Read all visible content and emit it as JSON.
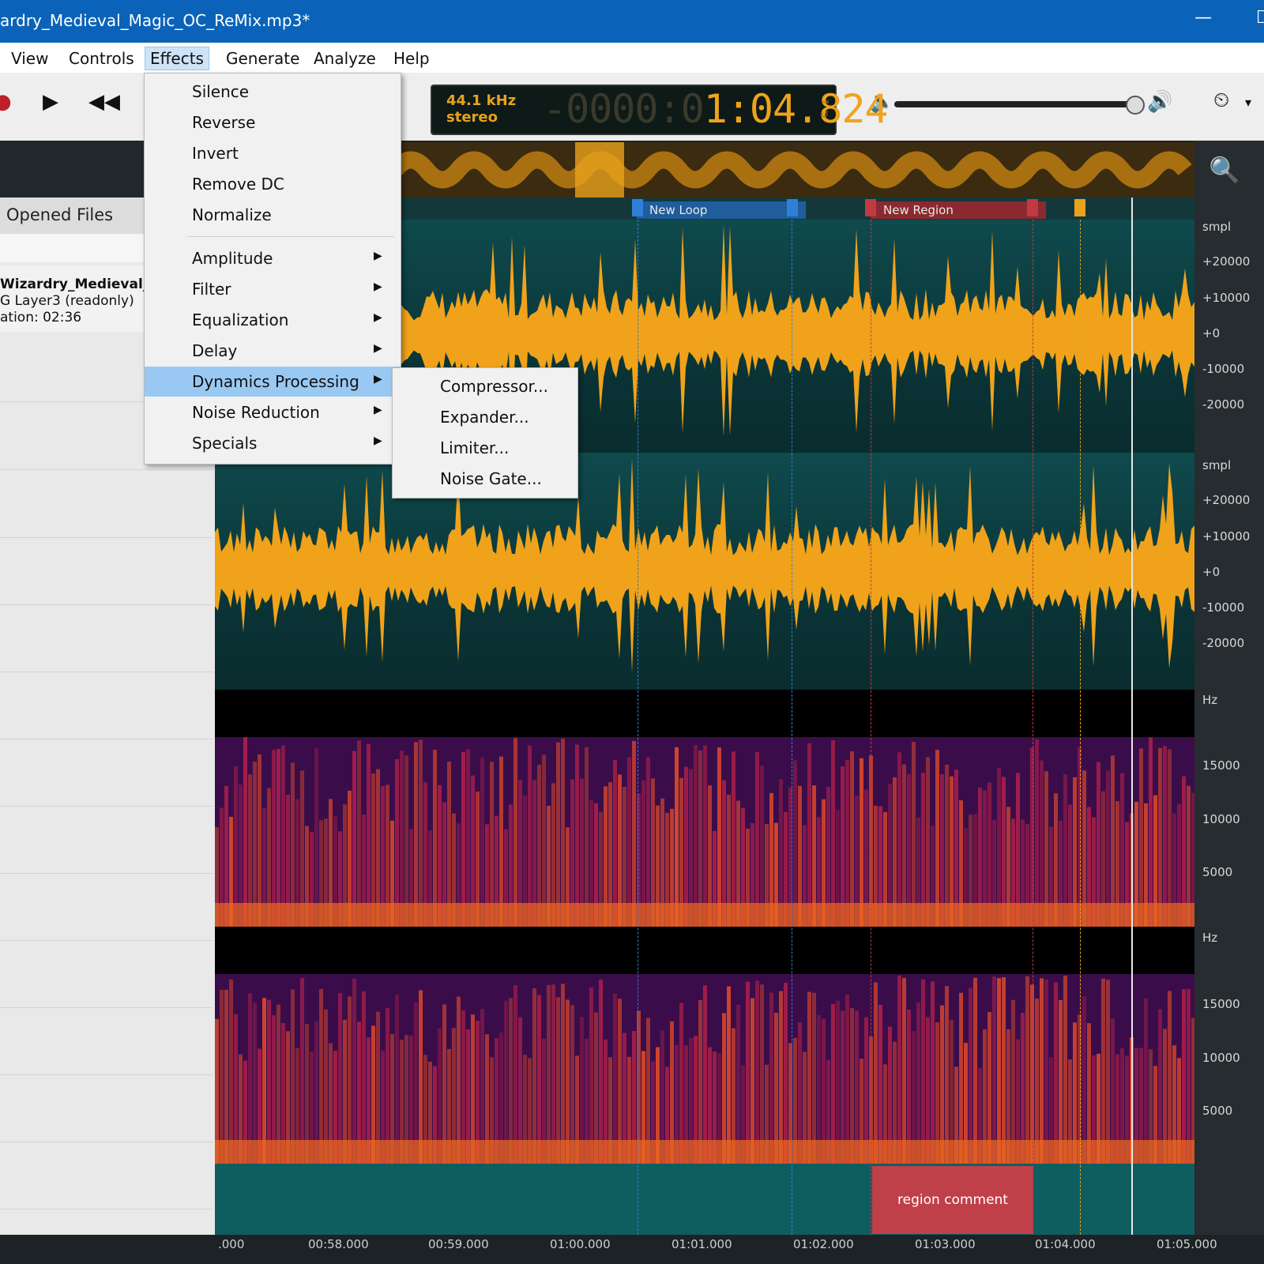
{
  "window": {
    "title": "ardry_Medieval_Magic_OC_ReMix.mp3*",
    "minimize_glyph": "—",
    "maximize_glyph": "☐"
  },
  "menubar": {
    "items": [
      "View",
      "Controls",
      "Effects",
      "Generate",
      "Analyze",
      "Help"
    ],
    "active": "Effects"
  },
  "display": {
    "sample_rate": "44.1 kHz",
    "channels": "stereo",
    "time_dim": "-0000:0",
    "time": "1:04.824"
  },
  "left_panel": {
    "heading": "Opened Files",
    "file": {
      "name": "Wizardry_Medieval_M",
      "format": "G Layer3 (readonly)",
      "duration": "ation: 02:36"
    }
  },
  "markers": [
    {
      "label": "New Loop",
      "color": "#2f7fd6"
    },
    {
      "label": "New Region",
      "color": "#b5383f"
    }
  ],
  "region_comment": "region comment",
  "amplitude_scale": [
    "smpl",
    "+20000",
    "+10000",
    "+0",
    "-10000",
    "-20000"
  ],
  "frequency_scale": [
    "Hz",
    "15000",
    "10000",
    "5000"
  ],
  "time_ruler": [
    ".000",
    "00:58.000",
    "00:59.000",
    "01:00.000",
    "01:01.000",
    "01:02.000",
    "01:03.000",
    "01:04.000",
    "01:05.000"
  ],
  "effects_menu": {
    "group1": [
      "Silence",
      "Reverse",
      "Invert",
      "Remove DC",
      "Normalize"
    ],
    "group2": [
      "Amplitude",
      "Filter",
      "Equalization",
      "Delay",
      "Dynamics Processing",
      "Noise Reduction",
      "Specials"
    ],
    "highlighted": "Dynamics Processing"
  },
  "dynamics_submenu": [
    "Compressor...",
    "Expander...",
    "Limiter...",
    "Noise Gate..."
  ],
  "colors": {
    "titlebar": "#0a63b8",
    "waveform": "#f0a31a",
    "highlight": "#99c9f3",
    "region": "#c0404a"
  }
}
